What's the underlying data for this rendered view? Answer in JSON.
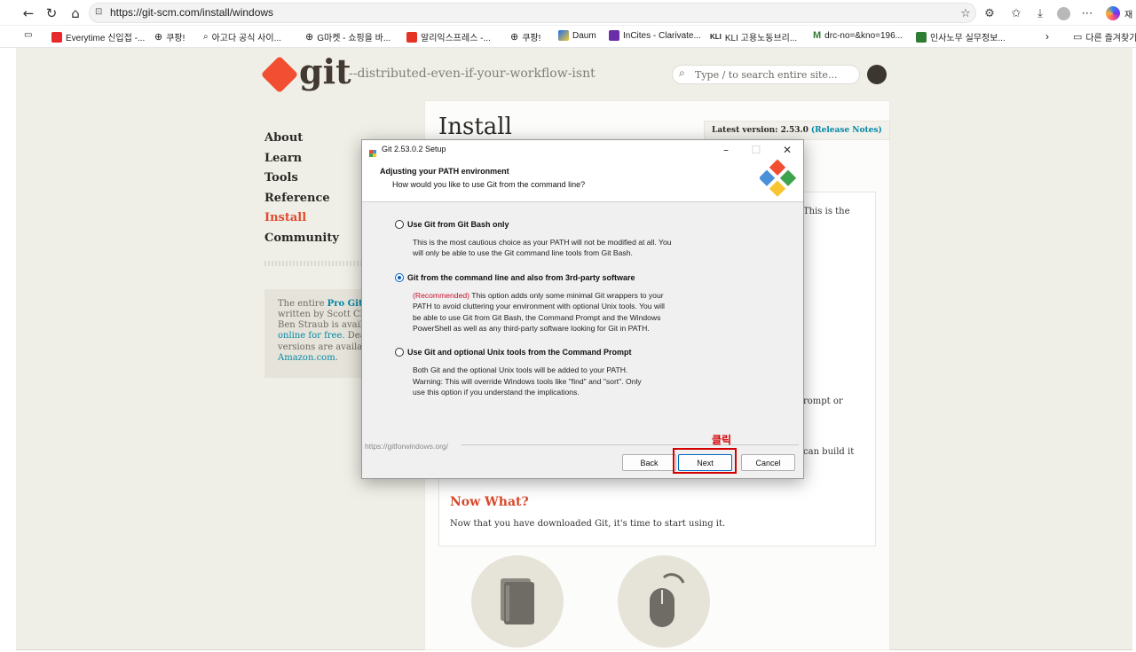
{
  "browser": {
    "url": "https://git-scm.com/install/windows",
    "bookmarks": [
      "Everytime 신입접 -...",
      "쿠팡!",
      "아고다 공식 사이...",
      "G마켓 - 쇼핑을 바...",
      "알리익스프레스 -...",
      "쿠팡!",
      "Daum",
      "InCites - Clarivate...",
      "KLI 고용노동브리...",
      "drc-no=&kno=196...",
      "인사노무 실무정보...",
      "다른 즐겨찾기"
    ],
    "profile_letter": "재"
  },
  "site": {
    "logo_text": "git",
    "tagline": "--distributed-even-if-your-workflow-isnt",
    "search_placeholder": "Type / to search entire site...",
    "nav": [
      "About",
      "Learn",
      "Tools",
      "Reference",
      "Install",
      "Community"
    ],
    "active_nav": "Install",
    "sidebar_box": {
      "line1_pre": "The entire ",
      "line1_bold": "Pro Git bo",
      "line2": "written by Scott Chaco",
      "line3": "Ben Straub is available",
      "line4_link": "online for free.",
      "line4_rest": " Dead t",
      "line5": "versions are available",
      "line6_link": "Amazon.com",
      "line6_rest": "."
    },
    "page_title": "Install",
    "latest_version_label": "Latest version: 2.53.0",
    "release_notes_link": "(Release Notes)",
    "bg_fragments": [
      "This is the",
      "rompt or",
      "can build it"
    ],
    "now_what_title": "Now What?",
    "now_what_text": "Now that you have downloaded Git, it's time to start using it."
  },
  "dialog": {
    "title": "Git 2.53.0.2 Setup",
    "heading": "Adjusting your PATH environment",
    "subheading": "How would you like to use Git from the command line?",
    "options": [
      {
        "label": "Use Git from Git Bash only",
        "checked": false,
        "desc": [
          "This is the most cautious choice as your PATH will not be modified at all. You",
          "will only be able to use the Git command line tools from Git Bash."
        ]
      },
      {
        "label": "Git from the command line and also from 3rd-party software",
        "checked": true,
        "desc_red_prefix": "(Recommended)",
        "desc": [
          " This option adds only some minimal Git wrappers to your",
          "PATH to avoid cluttering your environment with optional Unix tools. You will",
          "be able to use Git from Git Bash, the Command Prompt and the Windows",
          "PowerShell as well as any third-party software looking for Git in PATH."
        ]
      },
      {
        "label": "Use Git and optional Unix tools from the Command Prompt",
        "checked": false,
        "desc": [
          "Both Git and the optional Unix tools will be added to your PATH."
        ],
        "warning": [
          "Warning: This will override Windows tools like \"find\" and \"sort\". Only",
          "use this option if you understand the implications."
        ]
      }
    ],
    "footer_url": "https://gitforwindows.org/",
    "buttons": {
      "back": "Back",
      "next": "Next",
      "cancel": "Cancel"
    }
  },
  "annotation": {
    "text": "클릭",
    "color": "#d40000"
  },
  "colors": {
    "git_orange": "#f14e32",
    "link": "#0388a6",
    "focus_blue": "#0067c0"
  }
}
